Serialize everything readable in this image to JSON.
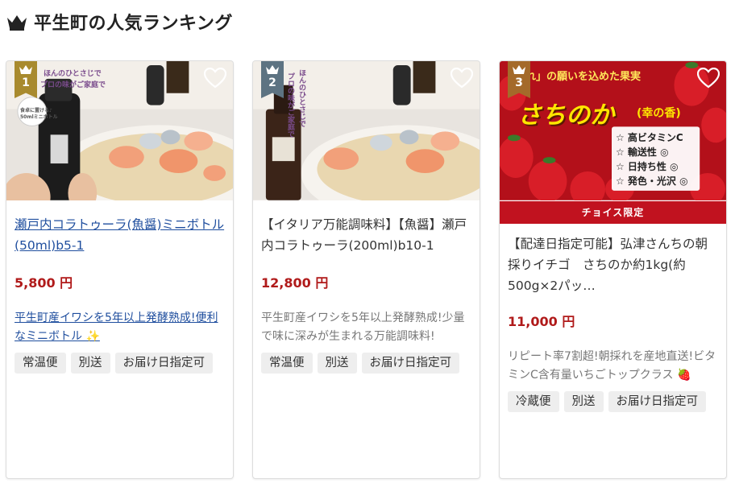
{
  "page": {
    "heading": "平生町の人気ランキング"
  },
  "colors": {
    "gold": "#a88a2e",
    "silver": "#5d7382",
    "bronze": "#a46a2a",
    "price": "#b01a1a",
    "link": "#1f4e9e",
    "choice": "#c1121f"
  },
  "cards": [
    {
      "rank": "1",
      "title": "瀬戸内コラトゥーラ(魚醤)ミニボトル(50ml)b5-1",
      "price": "5,800 円",
      "desc": "平生町産イワシを5年以上発酵熟成!便利なミニボトル ✨",
      "tags": [
        "常温便",
        "別送",
        "お届け日指定可"
      ],
      "image_text": [
        "ほんのひとさじで",
        "プロの味がご家庭で",
        "食卓に置ける♪",
        "50mlミニボトル"
      ]
    },
    {
      "rank": "2",
      "title": "【イタリア万能調味料】【魚醤】瀬戸内コラトゥーラ(200ml)b10-1",
      "price": "12,800 円",
      "desc": "平生町産イワシを5年以上発酵熟成!少量で味に深みが生まれる万能調味料!",
      "tags": [
        "常温便",
        "別送",
        "お届け日指定可"
      ],
      "image_text": [
        "ほんのひとさじで",
        "プロの味がご家庭で"
      ]
    },
    {
      "rank": "3",
      "title": "【配達日指定可能】弘津さんちの朝採りイチゴ　さちのか約1kg(約500g×2パッ…",
      "price": "11,000 円",
      "desc": "リピート率7割超!朝採れを産地直送!ビタミンC含有量いちごトップクラス 🍓",
      "tags": [
        "冷蔵便",
        "別送",
        "お届け日指定可"
      ],
      "badge": "チョイス限定",
      "image_text": [
        "れ」の願いを込めた果実",
        "さちのか",
        "(幸の香)",
        "☆ 高ビタミンC",
        "☆ 輸送性 ◎",
        "☆ 日持ち性 ◎",
        "☆ 発色・光沢 ◎"
      ]
    }
  ]
}
